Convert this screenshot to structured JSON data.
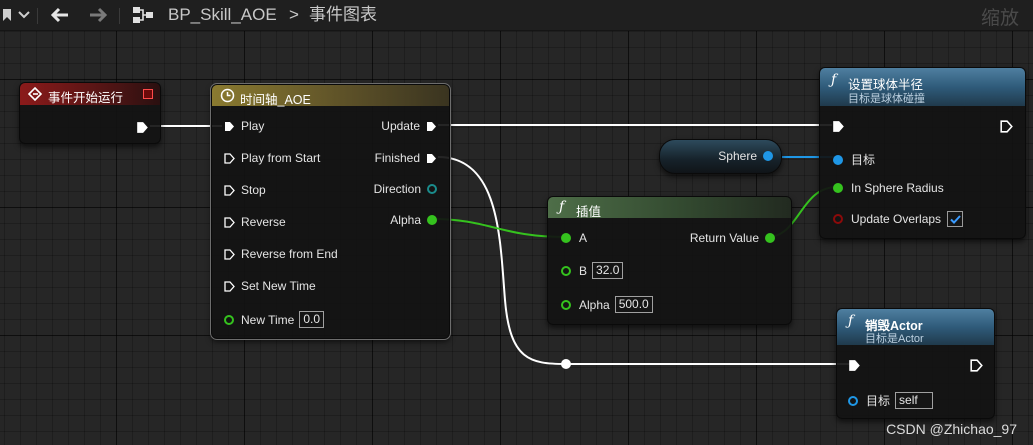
{
  "toolbar": {
    "breadcrumb": {
      "blueprint": "BP_Skill_AOE",
      "separator": ">",
      "graph": "事件图表"
    },
    "zoom_label": "缩放"
  },
  "nodes": {
    "event_begin_play": {
      "title": "事件开始运行",
      "color": "#8b1a1a"
    },
    "timeline": {
      "title": "时间轴_AOE",
      "color": "#7a6a26",
      "inputs": [
        "Play",
        "Play from Start",
        "Stop",
        "Reverse",
        "Reverse from End",
        "Set New Time"
      ],
      "new_time_label": "New Time",
      "new_time_value": "0.0",
      "outputs": [
        "Update",
        "Finished",
        "Direction",
        "Alpha"
      ]
    },
    "sphere_ref": {
      "label": "Sphere"
    },
    "lerp": {
      "title": "插值",
      "color": "#3d5a3a",
      "a_label": "A",
      "b_label": "B",
      "b_value": "32.0",
      "alpha_label": "Alpha",
      "alpha_value": "500.0",
      "return_label": "Return Value"
    },
    "set_sphere_radius": {
      "title": "设置球体半径",
      "subtitle": "目标是球体碰撞",
      "color": "#2f5b7a",
      "target_label": "目标",
      "radius_label": "In Sphere Radius",
      "overlaps_label": "Update Overlaps",
      "overlaps_checked": true
    },
    "destroy_actor": {
      "title": "销毁Actor",
      "subtitle": "目标是Actor",
      "color": "#2f5b7a",
      "target_label": "目标",
      "target_value": "self"
    }
  },
  "credit": "CSDN @Zhichao_97",
  "colors": {
    "exec_wire": "#ffffff",
    "float_pin": "#35c21e",
    "object_pin": "#1f97e6",
    "bool_pin": "#8c0a0a",
    "direction_pin": "#1a8c8c"
  }
}
